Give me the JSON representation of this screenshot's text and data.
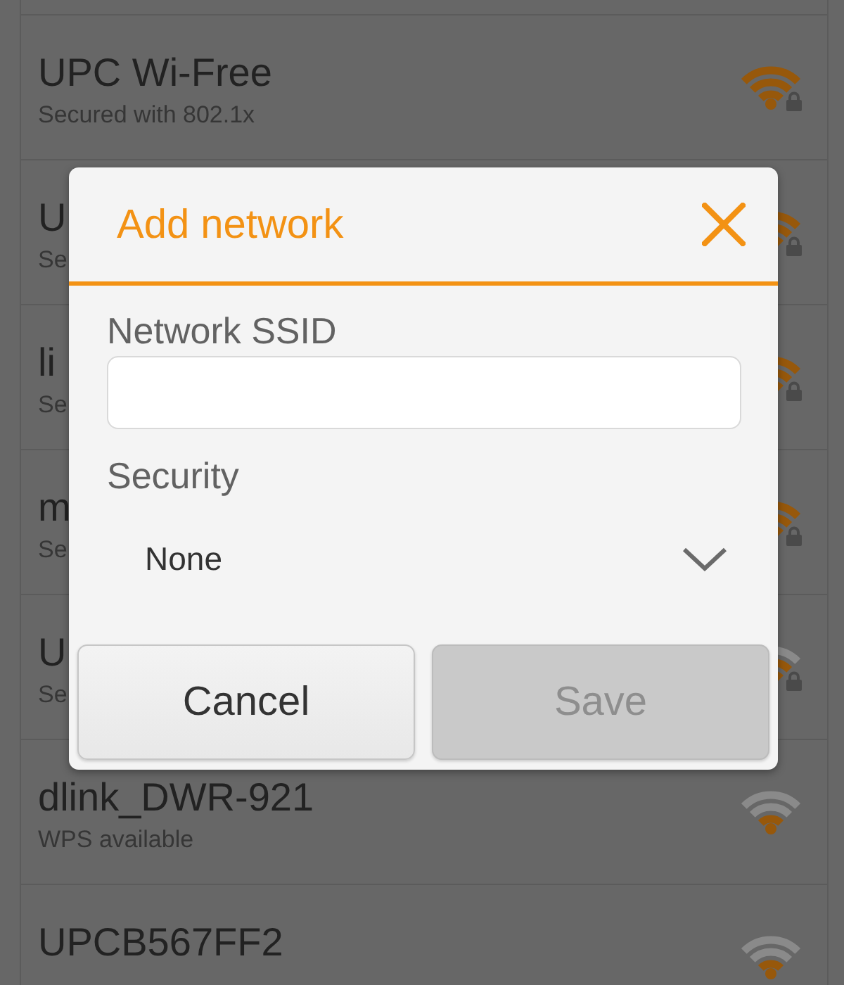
{
  "networks": [
    {
      "name": "UPC Wi-Free",
      "status": "Secured with 802.1x",
      "secured": true,
      "kind": "full"
    },
    {
      "name": "U",
      "status": "Se",
      "secured": true,
      "kind": "full"
    },
    {
      "name": "li",
      "status": "Se",
      "secured": true,
      "kind": "full"
    },
    {
      "name": "m",
      "status": "Se",
      "secured": true,
      "kind": "full"
    },
    {
      "name": "U",
      "status": "Se",
      "secured": true,
      "kind": "good"
    },
    {
      "name": "dlink_DWR-921",
      "status": "WPS available",
      "secured": false,
      "kind": "fair"
    },
    {
      "name": "UPCB567FF2",
      "secured": false,
      "kind": "fair"
    }
  ],
  "dialog": {
    "title": "Add network",
    "ssid": {
      "label": "Network SSID"
    },
    "security": {
      "label": "Security",
      "value": "None"
    },
    "buttons": [
      {
        "label": "Cancel",
        "disabled": false
      },
      {
        "label": "Save",
        "disabled": true
      }
    ]
  }
}
